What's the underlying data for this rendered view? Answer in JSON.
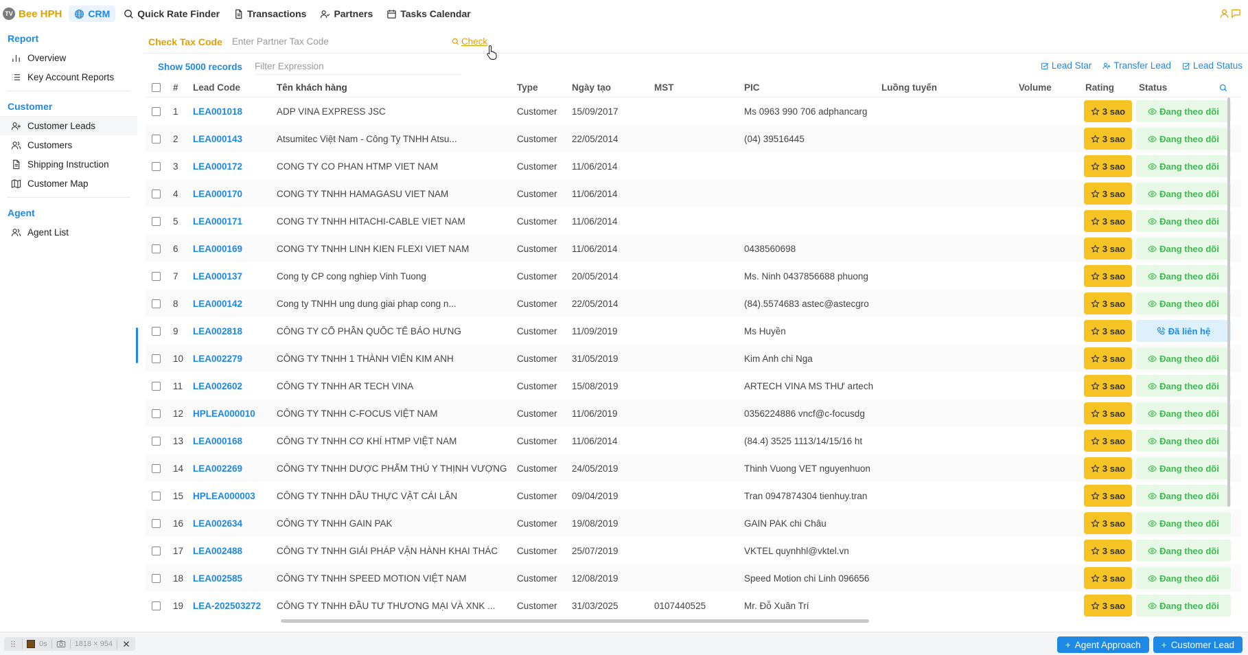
{
  "brand": {
    "logo_text": "TV",
    "name": "Bee HPH"
  },
  "nav": [
    {
      "label": "CRM",
      "icon": "globe-icon",
      "active": true
    },
    {
      "label": "Quick Rate Finder",
      "icon": "search-icon",
      "active": false
    },
    {
      "label": "Transactions",
      "icon": "document-icon",
      "active": false
    },
    {
      "label": "Partners",
      "icon": "partners-icon",
      "active": false
    },
    {
      "label": "Tasks Calendar",
      "icon": "calendar-icon",
      "active": false
    }
  ],
  "sidebar": {
    "sections": [
      {
        "title": "Report",
        "items": [
          {
            "label": "Overview",
            "icon": "bar-chart-icon"
          },
          {
            "label": "Key Account Reports",
            "icon": "list-icon"
          }
        ]
      },
      {
        "title": "Customer",
        "items": [
          {
            "label": "Customer Leads",
            "icon": "user-plus-icon",
            "active": true
          },
          {
            "label": "Customers",
            "icon": "users-icon"
          },
          {
            "label": "Shipping Instruction",
            "icon": "file-icon"
          },
          {
            "label": "Customer Map",
            "icon": "map-icon"
          }
        ]
      },
      {
        "title": "Agent",
        "items": [
          {
            "label": "Agent List",
            "icon": "users-icon"
          }
        ]
      }
    ]
  },
  "tax_check": {
    "label": "Check Tax Code",
    "placeholder": "Enter Partner Tax Code",
    "button": "Check"
  },
  "filter": {
    "show_records": "Show 5000 records",
    "placeholder": "Filter Expression"
  },
  "toolbar": {
    "lead_star": "Lead Star",
    "transfer_lead": "Transfer Lead",
    "lead_status": "Lead Status"
  },
  "table": {
    "columns": {
      "num": "#",
      "code": "Lead Code",
      "name": "Tên khách hàng",
      "type": "Type",
      "date": "Ngày tạo",
      "mst": "MST",
      "pic": "PIC",
      "route": "Luồng tuyến",
      "volume": "Volume",
      "rating": "Rating",
      "status": "Status"
    },
    "rows": [
      {
        "num": "1",
        "code": "LEA001018",
        "name": "ADP VINA EXPRESS JSC",
        "type": "Customer",
        "date": "15/09/2017",
        "mst": "",
        "pic": "Ms 0963 990 706 adphancarg",
        "rating": "3 sao",
        "status": "Đang theo dõi",
        "status_kind": "follow"
      },
      {
        "num": "2",
        "code": "LEA000143",
        "name": "Atsumitec Việt Nam - Công Ty TNHH Atsu...",
        "type": "Customer",
        "date": "22/05/2014",
        "mst": "",
        "pic": "(04) 39516445",
        "rating": "3 sao",
        "status": "Đang theo dõi",
        "status_kind": "follow"
      },
      {
        "num": "3",
        "code": "LEA000172",
        "name": "CONG TY CO PHAN HTMP VIET NAM",
        "type": "Customer",
        "date": "11/06/2014",
        "mst": "",
        "pic": "",
        "rating": "3 sao",
        "status": "Đang theo dõi",
        "status_kind": "follow"
      },
      {
        "num": "4",
        "code": "LEA000170",
        "name": "CONG TY TNHH HAMAGASU VIET NAM",
        "type": "Customer",
        "date": "11/06/2014",
        "mst": "",
        "pic": "",
        "rating": "3 sao",
        "status": "Đang theo dõi",
        "status_kind": "follow"
      },
      {
        "num": "5",
        "code": "LEA000171",
        "name": "CONG TY TNHH HITACHI-CABLE VIET NAM",
        "type": "Customer",
        "date": "11/06/2014",
        "mst": "",
        "pic": "",
        "rating": "3 sao",
        "status": "Đang theo dõi",
        "status_kind": "follow"
      },
      {
        "num": "6",
        "code": "LEA000169",
        "name": "CONG TY TNHH LINH KIEN FLEXI VIET NAM",
        "type": "Customer",
        "date": "11/06/2014",
        "mst": "",
        "pic": "0438560698",
        "rating": "3 sao",
        "status": "Đang theo dõi",
        "status_kind": "follow"
      },
      {
        "num": "7",
        "code": "LEA000137",
        "name": "Cong ty CP cong nghiep Vinh Tuong",
        "type": "Customer",
        "date": "20/05/2014",
        "mst": "",
        "pic": "Ms. Ninh 0437856688 phuong",
        "rating": "3 sao",
        "status": "Đang theo dõi",
        "status_kind": "follow"
      },
      {
        "num": "8",
        "code": "LEA000142",
        "name": "Cong ty TNHH ung dung giai phap cong n...",
        "type": "Customer",
        "date": "22/05/2014",
        "mst": "",
        "pic": "(84).5574683 astec@astecgro",
        "rating": "3 sao",
        "status": "Đang theo dõi",
        "status_kind": "follow"
      },
      {
        "num": "9",
        "code": "LEA002818",
        "name": "CÔNG TY CỔ PHẦN QUỐC TẾ BẢO HƯNG",
        "type": "Customer",
        "date": "11/09/2019",
        "mst": "",
        "pic": "Ms Huyền",
        "rating": "3 sao",
        "status": "Đã liên hệ",
        "status_kind": "contacted"
      },
      {
        "num": "10",
        "code": "LEA002279",
        "name": "CÔNG TY TNHH 1 THÀNH VIÊN KIM ANH",
        "type": "Customer",
        "date": "31/05/2019",
        "mst": "",
        "pic": "Kim Anh chi Nga",
        "rating": "3 sao",
        "status": "Đang theo dõi",
        "status_kind": "follow"
      },
      {
        "num": "11",
        "code": "LEA002602",
        "name": "CÔNG TY TNHH AR TECH VINA",
        "type": "Customer",
        "date": "15/08/2019",
        "mst": "",
        "pic": "ARTECH VINA MS THƯ artech",
        "rating": "3 sao",
        "status": "Đang theo dõi",
        "status_kind": "follow"
      },
      {
        "num": "12",
        "code": "HPLEA000010",
        "name": "CÔNG TY TNHH C-FOCUS VIỆT NAM",
        "type": "Customer",
        "date": "11/06/2019",
        "mst": "",
        "pic": "0356224886 vncf@c-focusdg",
        "rating": "3 sao",
        "status": "Đang theo dõi",
        "status_kind": "follow"
      },
      {
        "num": "13",
        "code": "LEA000168",
        "name": "CÔNG TY TNHH CƠ KHÍ HTMP VIỆT NAM",
        "type": "Customer",
        "date": "11/06/2014",
        "mst": "",
        "pic": "(84.4) 3525 1113/14/15/16 ht",
        "rating": "3 sao",
        "status": "Đang theo dõi",
        "status_kind": "follow"
      },
      {
        "num": "14",
        "code": "LEA002269",
        "name": "CÔNG TY TNHH DƯỢC PHẨM THÚ Y THỊNH VƯỢNG",
        "type": "Customer",
        "date": "24/05/2019",
        "mst": "",
        "pic": "Thinh Vuong VET nguyenhuon",
        "rating": "3 sao",
        "status": "Đang theo dõi",
        "status_kind": "follow"
      },
      {
        "num": "15",
        "code": "HPLEA000003",
        "name": "CÔNG TY TNHH DẦU THỰC VẬT CÁI LÂN",
        "type": "Customer",
        "date": "09/04/2019",
        "mst": "",
        "pic": "Tran 0947874304 tienhuy.tran",
        "rating": "3 sao",
        "status": "Đang theo dõi",
        "status_kind": "follow"
      },
      {
        "num": "16",
        "code": "LEA002634",
        "name": "CÔNG TY TNHH GAIN PAK",
        "type": "Customer",
        "date": "19/08/2019",
        "mst": "",
        "pic": "GAIN PAK chi Châu",
        "rating": "3 sao",
        "status": "Đang theo dõi",
        "status_kind": "follow"
      },
      {
        "num": "17",
        "code": "LEA002488",
        "name": "CÔNG TY TNHH GIẢI PHÁP VẬN HÀNH KHAI THÁC",
        "type": "Customer",
        "date": "25/07/2019",
        "mst": "",
        "pic": "VKTEL quynhhl@vktel.vn",
        "rating": "3 sao",
        "status": "Đang theo dõi",
        "status_kind": "follow"
      },
      {
        "num": "18",
        "code": "LEA002585",
        "name": "CÔNG TY TNHH SPEED MOTION VIỆT NAM",
        "type": "Customer",
        "date": "12/08/2019",
        "mst": "",
        "pic": "Speed Motion chi Linh 096656",
        "rating": "3 sao",
        "status": "Đang theo dõi",
        "status_kind": "follow"
      },
      {
        "num": "19",
        "code": "LEA-202503272",
        "name": "CÔNG TY TNHH ĐẦU TƯ THƯƠNG MẠI VÀ XNK ...",
        "type": "Customer",
        "date": "31/03/2025",
        "mst": "0107440525",
        "pic": "Mr. Đỗ Xuân Trí",
        "rating": "3 sao",
        "status": "Đang theo dõi",
        "status_kind": "follow"
      }
    ]
  },
  "recorder": {
    "time": "0s",
    "size": "1818 × 954"
  },
  "bottom_buttons": {
    "agent_approach": "Agent Approach",
    "customer_lead": "Customer Lead"
  },
  "colors": {
    "accent": "#1e88e5",
    "brand": "#e0a100",
    "rating": "#f6c324",
    "status_follow": "#3fb950",
    "status_contacted": "#1e88e5"
  }
}
